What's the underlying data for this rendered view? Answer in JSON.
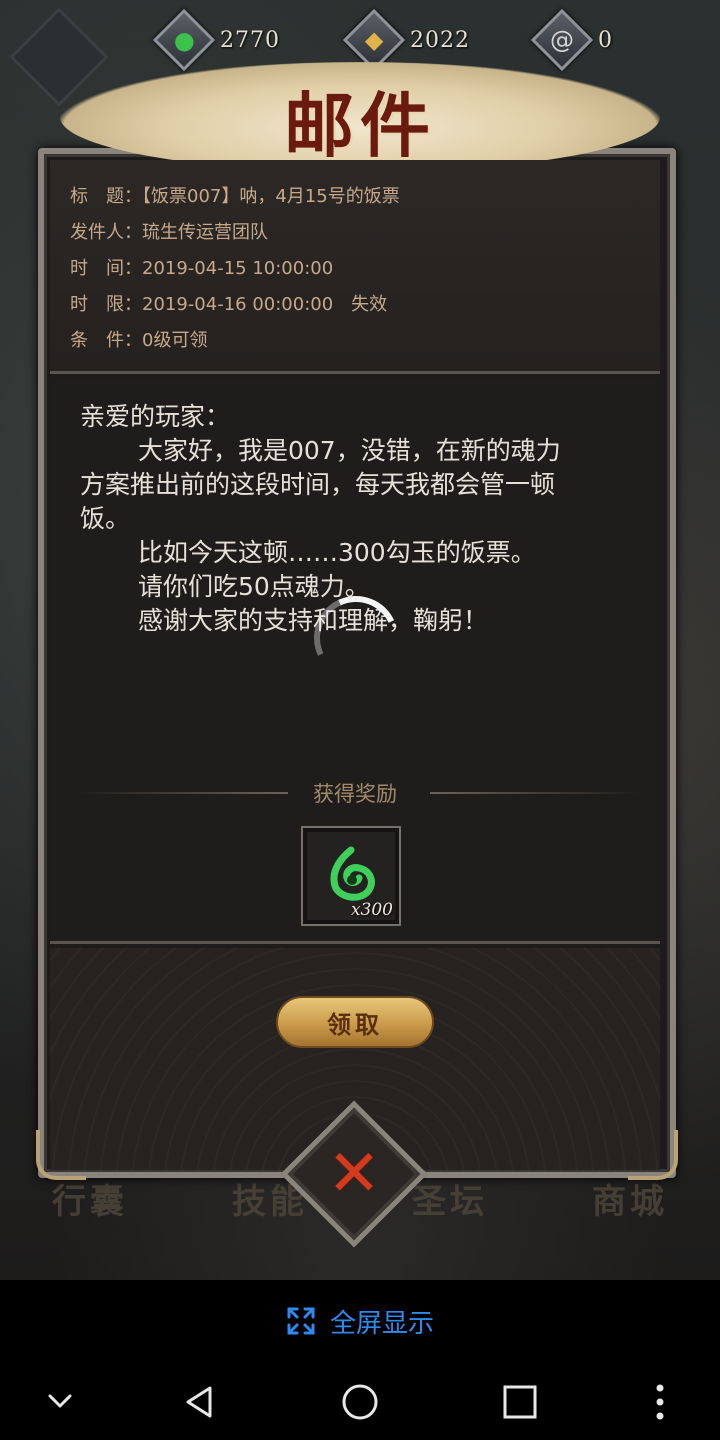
{
  "currencies": [
    {
      "name": "gouyu",
      "icon": "green-magatama-icon",
      "amount": "2770",
      "color": "#2fa83a"
    },
    {
      "name": "coin",
      "icon": "gold-coin-icon",
      "amount": "2022",
      "color": "#d6a43b"
    },
    {
      "name": "soul",
      "icon": "swirl-icon",
      "amount": "0",
      "color": "#c9c9c9"
    }
  ],
  "mail": {
    "title": "邮件",
    "meta": [
      {
        "label": "标　题：",
        "value": "【饭票007】呐，4月15号的饭票"
      },
      {
        "label": "发件人：",
        "value": "琉生传运营团队"
      },
      {
        "label": "时　间：",
        "value": "2019-04-15 10:00:00"
      },
      {
        "label": "时　限：",
        "value": "2019-04-16 00:00:00　失效"
      },
      {
        "label": "条　件：",
        "value": "0级可领"
      }
    ],
    "body": {
      "greeting": "亲爱的玩家：",
      "para1_line1": "大家好，我是007，没错，在新的魂力",
      "para1_line2": "方案推出前的这段时间，每天我都会管一顿",
      "para1_line3": "饭。",
      "line2": "比如今天这顿……300勾玉的饭票。",
      "line3": "请你们吃50点魂力。",
      "line4": "感谢大家的支持和理解，鞠躬！"
    },
    "reward_title": "获得奖励",
    "reward": {
      "icon": "green-magatama-icon",
      "count": "x300"
    },
    "claim_label": "领取"
  },
  "background_labels": [
    "行囊",
    "技能",
    "圣坛",
    "商城"
  ],
  "fullscreen_label": "全屏显示",
  "nav": [
    "collapse-icon",
    "back-icon",
    "home-icon",
    "recents-icon",
    "more-icon"
  ]
}
